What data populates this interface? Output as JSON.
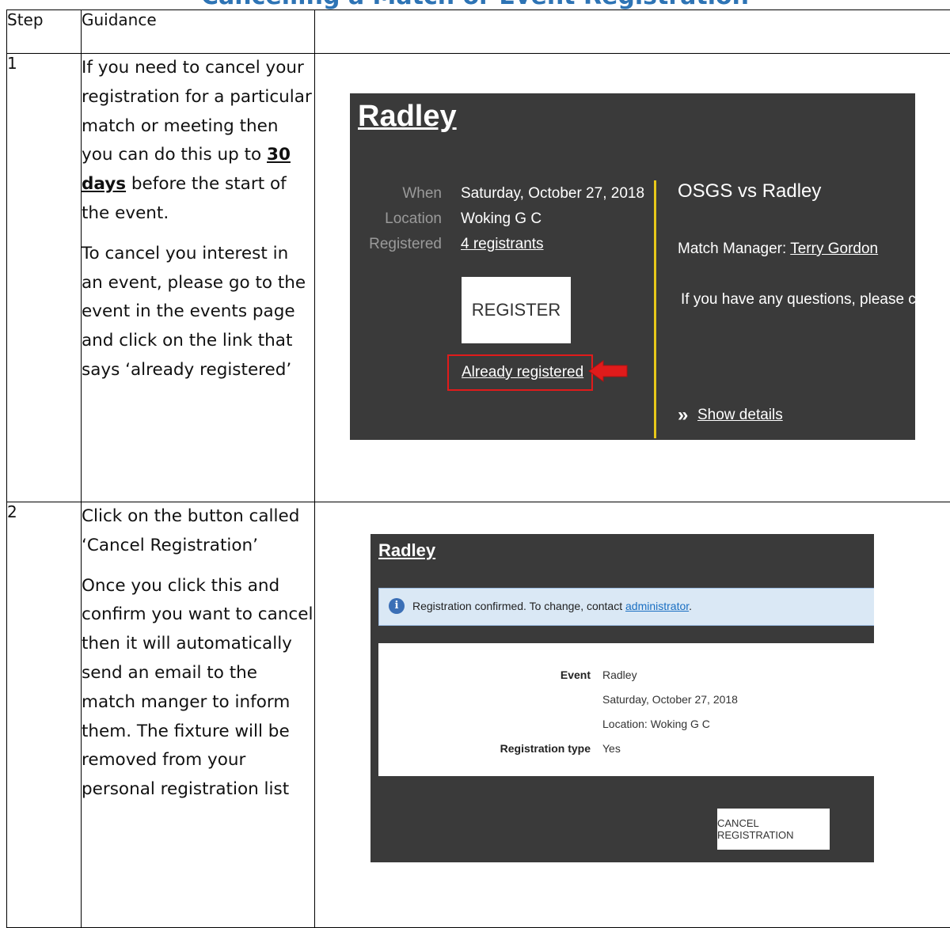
{
  "page_title": "Cancelling a Match or Event Registration",
  "table": {
    "header": {
      "step": "Step",
      "guidance": "Guidance"
    },
    "rows": [
      {
        "step": "1",
        "p1_a": "If you need to cancel your registration for a particular match or meeting then you can do this up to ",
        "p1_days": "30 days",
        "p1_b": " before the start of the event.",
        "p2": "To cancel you interest in an event, please go to the event in the events page and click on the link that says ‘already registered’"
      },
      {
        "step": "2",
        "p1": "Click on the button called ‘Cancel Registration’",
        "p2": "Once you click this and confirm you want to cancel then it will automatically send an email to the match manger to inform them. The fixture will be removed from your personal registration list"
      }
    ]
  },
  "screenshot1": {
    "event_title": "Radley",
    "when_label": "When",
    "when_value": "Saturday, October 27, 2018",
    "location_label": "Location",
    "location_value": "Woking G C",
    "registered_label": "Registered",
    "registered_value": "4 registrants",
    "register_button": "REGISTER",
    "already_registered": "Already registered",
    "match_title": "OSGS vs Radley",
    "manager_label": "Match Manager: ",
    "manager_name": "Terry Gordon",
    "questions_text": "If you have any questions, please contact",
    "show_details": "Show details",
    "chevron": "»",
    "accent_color": "#e8c81a",
    "highlight_color": "#e01b1b"
  },
  "screenshot2": {
    "event_title": "Radley",
    "banner_text": "Registration confirmed. To change, contact ",
    "banner_link": "administrator",
    "banner_end": ".",
    "info_icon": "i",
    "event_label": "Event",
    "event_value": "Radley",
    "date_value": "Saturday, October 27, 2018",
    "location_value": "Location: Woking G C",
    "regtype_label": "Registration type",
    "regtype_value": "Yes",
    "cancel_button": "CANCEL REGISTRATION"
  }
}
